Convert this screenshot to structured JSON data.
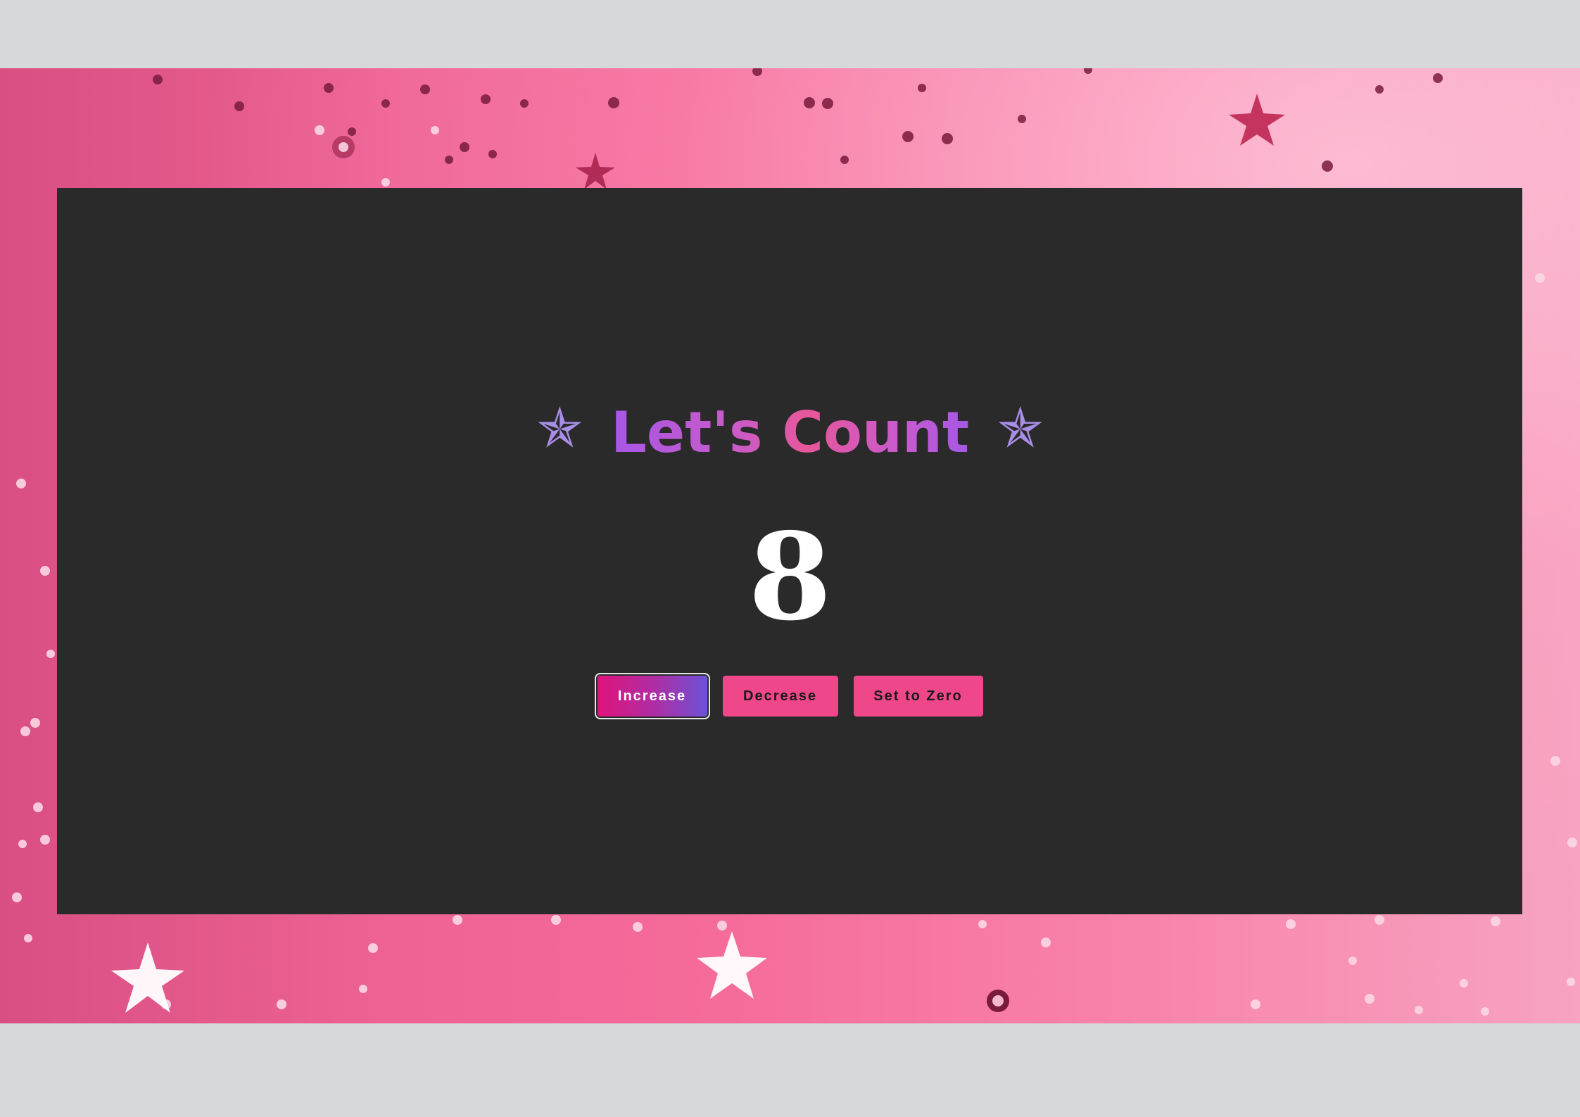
{
  "title": {
    "left_icon": "star-icon",
    "text": "Let's Count",
    "right_icon": "star-icon",
    "icon_glyph": "✯"
  },
  "counter": {
    "value": "8"
  },
  "buttons": {
    "increase_label": "Increase",
    "decrease_label": "Decrease",
    "zero_label": "Set to Zero"
  },
  "colors": {
    "panel": "#2a2a2a",
    "accent_pink": "#f0468a",
    "gradient_start": "#e0137c",
    "gradient_end": "#6d52d6",
    "star": "#a98ee8"
  }
}
